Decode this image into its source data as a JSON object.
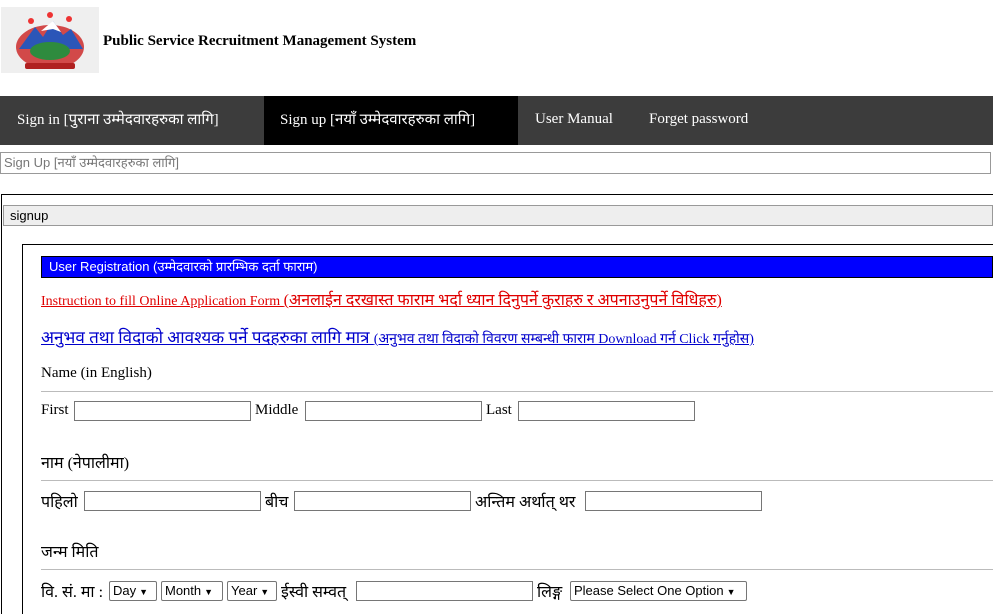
{
  "header": {
    "logo_icon": "nepal-emblem-icon",
    "title": "Public Service Recruitment Management System"
  },
  "nav": {
    "items": [
      {
        "label": "Sign in [पुराना उम्मेदवारहरुका लागि]",
        "active": false
      },
      {
        "label": "Sign up [नयाँ उम्मेदवारहरुका लागि]",
        "active": true
      },
      {
        "label": "User Manual",
        "active": false
      },
      {
        "label": "Forget password",
        "active": false
      }
    ]
  },
  "breadcrumb": "Sign Up [नयाँ उम्मेदवारहरुका लागि]",
  "section_bar": "signup",
  "form": {
    "header": "User Registration (उम्मेदवारको प्रारम्भिक दर्ता फाराम)",
    "instruction_link_en": "Instruction to fill Online Application Form ",
    "instruction_link_np": "(अनलाईन दरखास्त फाराम भर्दा ध्यान दिनुपर्ने कुराहरु र अपनाउनुपर्ने विधिहरु)",
    "experience_link_np": "अनुभव तथा विदाको आवश्यक पर्ने पदहरुका लागि मात्र ",
    "experience_link_rest": "(अनुभव तथा विदाको विवरण सम्बन्धी फाराम Download गर्न Click गर्नुहोस)",
    "name_en_label": "Name (in English)",
    "first_label": "First",
    "middle_label": "Middle",
    "last_label": "Last",
    "first_value": "",
    "middle_value": "",
    "last_value": "",
    "name_np_label": "नाम (नेपालीमा)",
    "np_first_label": "पहिलो",
    "np_middle_label": "बीच",
    "np_last_label": "अन्तिम अर्थात् थर",
    "dob_label": "जन्म मिति",
    "bs_label": "वि. सं. मा :",
    "day_select": "Day",
    "month_select": "Month",
    "year_select": "Year",
    "ad_label": "ईस्वी सम्वत्",
    "gender_label": "लिङ्ग",
    "gender_select": "Please Select One Option"
  }
}
